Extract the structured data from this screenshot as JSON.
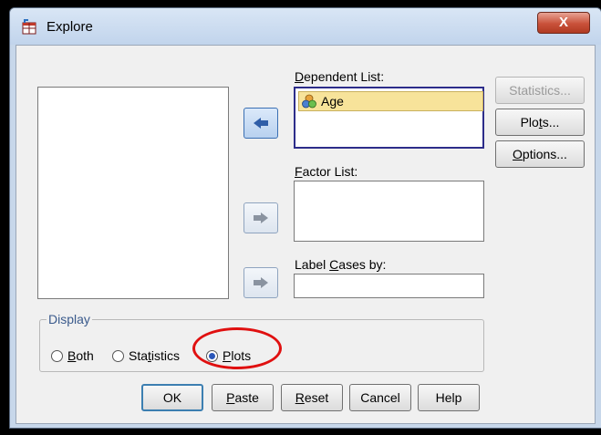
{
  "window": {
    "title": "Explore",
    "close_label": "X"
  },
  "source_list": {
    "items": []
  },
  "dependent": {
    "label": "Dependent List:",
    "items": [
      {
        "label": "Age",
        "icon": "scale-variable-icon"
      }
    ]
  },
  "factor": {
    "label": "Factor List:",
    "items": []
  },
  "label_cases": {
    "label": "Label Cases by:",
    "value": ""
  },
  "side_buttons": {
    "statistics": "Statistics...",
    "plots": "Plots...",
    "options": "Options..."
  },
  "display": {
    "legend": "Display",
    "options": [
      {
        "label": "Both",
        "checked": false
      },
      {
        "label": "Statistics",
        "checked": false
      },
      {
        "label": "Plots",
        "checked": true
      }
    ]
  },
  "bottom_buttons": {
    "ok": "OK",
    "paste": "Paste",
    "reset": "Reset",
    "cancel": "Cancel",
    "help": "Help"
  },
  "colors": {
    "highlight": "#f7e39a",
    "annotation": "#e01010",
    "accent": "#3c7fb1"
  }
}
